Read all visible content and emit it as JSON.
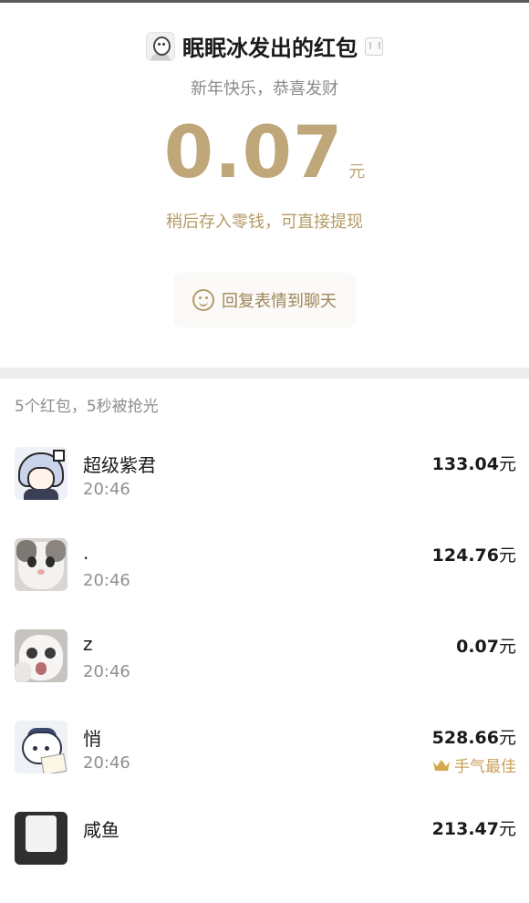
{
  "header": {
    "sender_title": "眠眠冰发出的红包",
    "greeting": "新年快乐，恭喜发财",
    "amount": "0.07",
    "amount_unit": "元",
    "deposit_note": "稍后存入零钱，可直接提现",
    "reply_label": "回复表情到聊天"
  },
  "list": {
    "summary": "5个红包，5秒被抢光",
    "recipients": [
      {
        "name": "超级紫君",
        "time": "20:46",
        "amount": "133.04",
        "unit": "元",
        "avatar": "anime-girl-avatar"
      },
      {
        "name": ".",
        "time": "20:46",
        "amount": "124.76",
        "unit": "元",
        "avatar": "cat-avatar"
      },
      {
        "name": "z",
        "time": "20:46",
        "amount": "0.07",
        "unit": "元",
        "avatar": "screaming-cat-avatar"
      },
      {
        "name": "悄",
        "time": "20:46",
        "amount": "528.66",
        "unit": "元",
        "avatar": "cartoon-cat-avatar",
        "best_label": "手气最佳"
      },
      {
        "name": "咸鱼",
        "time": "",
        "amount": "213.47",
        "unit": "元",
        "avatar": "shirt-avatar"
      }
    ]
  },
  "colors": {
    "gold": "#bfa77a",
    "gold_text": "#b59a66",
    "best_gold": "#c9a15a",
    "divider": "#ededed"
  }
}
